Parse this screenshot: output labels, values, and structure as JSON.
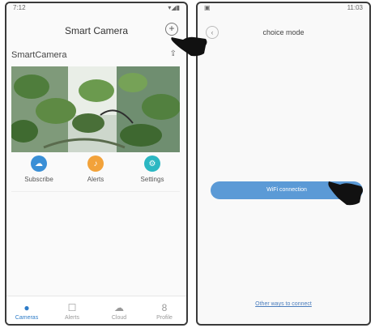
{
  "left_screen": {
    "status_time": "7:12",
    "title": "Smart Camera",
    "add_symbol": "+",
    "device_name": "SmartCamera",
    "features": [
      {
        "label": "Subscribe",
        "icon": "cloud-icon",
        "color": "#3a8fd6"
      },
      {
        "label": "Alerts",
        "icon": "bell-icon",
        "color": "#f2a23a"
      },
      {
        "label": "Settings",
        "icon": "gear-icon",
        "color": "#2bb7c2"
      }
    ],
    "tabs": [
      {
        "label": "Cameras",
        "icon": "camera-tab-icon",
        "glyph": "●",
        "active": true
      },
      {
        "label": "Alerts",
        "icon": "alert-tab-icon",
        "glyph": "☐",
        "active": false
      },
      {
        "label": "Cloud",
        "icon": "cloud-tab-icon",
        "glyph": "☁",
        "active": false
      },
      {
        "label": "Profile",
        "icon": "profile-tab-icon",
        "glyph": "8",
        "active": false
      }
    ]
  },
  "right_screen": {
    "status_time": "11:03",
    "title": "choice mode",
    "wifi_button": "WiFi connection",
    "other_link": "Other ways to connect"
  },
  "colors": {
    "accent": "#5b9ad6",
    "active_tab": "#2e7cc8"
  }
}
